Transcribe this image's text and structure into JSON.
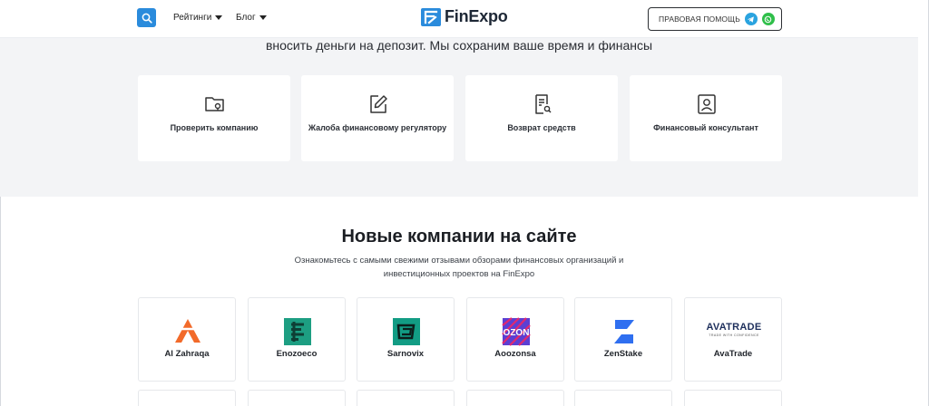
{
  "header": {
    "nav": [
      {
        "label": "Рейтинги"
      },
      {
        "label": "Блог"
      }
    ],
    "logo_text": "FinExpo",
    "legal_help_label": "ПРАВОВАЯ ПОМОЩЬ",
    "icons": {
      "search": "search-icon",
      "telegram": "telegram-icon",
      "whatsapp": "whatsapp-icon"
    },
    "colors": {
      "accent": "#2a8bdc",
      "telegram": "#2aa3df",
      "whatsapp": "#2fbf4a"
    }
  },
  "hero": {
    "text": "вносить деньги на депозит. Мы сохраним ваше время и финансы"
  },
  "services": [
    {
      "label": "Проверить компанию",
      "icon": "folder-check-icon"
    },
    {
      "label": "Жалоба финансовому регулятору",
      "icon": "edit-icon"
    },
    {
      "label": "Возврат средств",
      "icon": "document-search-icon"
    },
    {
      "label": "Финансовый консультант",
      "icon": "user-card-icon"
    }
  ],
  "new_companies": {
    "title": "Новые компании на сайте",
    "subtitle": "Ознакомьтесь с самыми свежими отзывами обзорами финансовых организаций и инвестиционных проектов на FinExpo",
    "items": [
      {
        "name": "Al Zahraqa",
        "logo": "al-zahraqa-logo",
        "color": "#f26a2a"
      },
      {
        "name": "Enozoeco",
        "logo": "enozoeco-logo",
        "color": "#1d9e82"
      },
      {
        "name": "Sarnovix",
        "logo": "sarnovix-logo",
        "color": "#129c84"
      },
      {
        "name": "Aoozonsa",
        "logo": "aoozonsa-logo",
        "color": "#5b3fd3",
        "logo_text": "OZON"
      },
      {
        "name": "ZenStake",
        "logo": "zenstake-logo",
        "color": "#2f6ff0"
      },
      {
        "name": "AvaTrade",
        "logo": "avatrade-logo",
        "color": "#1e2f5c",
        "logo_text": "AVATRADE",
        "logo_tagline": "TRADE WITH CONFIDENCE"
      }
    ]
  }
}
